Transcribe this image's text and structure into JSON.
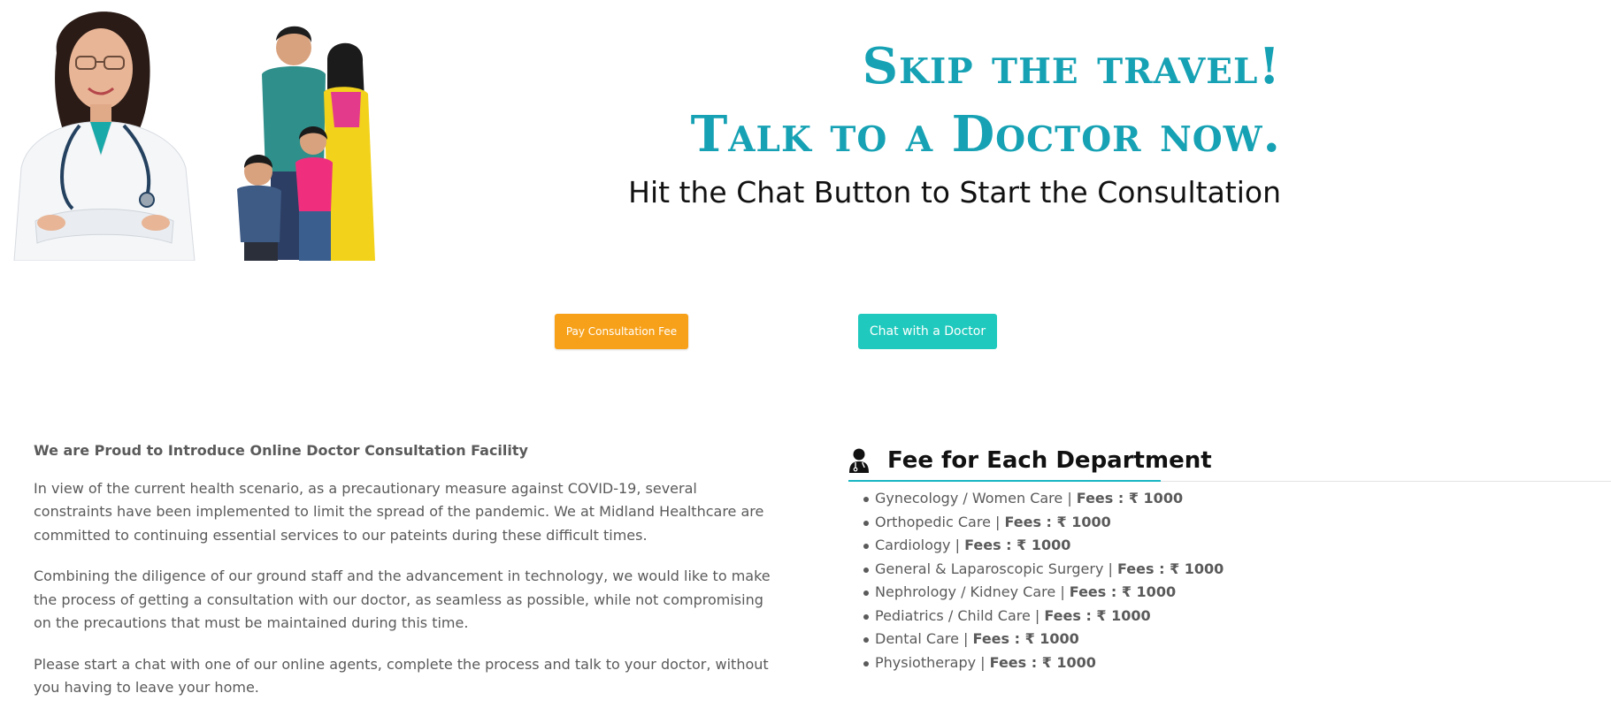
{
  "hero": {
    "line_1": "Skip the travel!",
    "line_2": "Talk to a Doctor now.",
    "subtitle": "Hit the Chat Button to Start the Consultation"
  },
  "buttons": {
    "pay_label": "Pay Consultation Fee",
    "chat_label": "Chat with a Doctor"
  },
  "intro": {
    "heading": "We are Proud to Introduce Online Doctor Consultation Facility",
    "paragraphs": [
      "In view of the current health scenario, as a precautionary measure against COVID-19, several constraints have been implemented to limit the spread of the pandemic. We at Midland Healthcare are committed to continuing essential services to our pateints during these difficult times.",
      "Combining the diligence of our ground staff and the advancement in technology, we would like to make the process of getting a consultation with our doctor, as seamless as possible, while not compromising on the precautions that must be maintained during this time.",
      "Please start a chat with one of our online agents, complete the process and talk to your doctor, without you having to leave your home."
    ]
  },
  "fees": {
    "title": "Fee for Each Department",
    "icon": "doctor-icon",
    "separator": " | ",
    "items": [
      {
        "department": "Gynecology / Women Care",
        "fee": "Fees : ₹ 1000"
      },
      {
        "department": "Orthopedic Care",
        "fee": "Fees : ₹ 1000"
      },
      {
        "department": "Cardiology",
        "fee": "Fees : ₹ 1000"
      },
      {
        "department": "General & Laparoscopic Surgery",
        "fee": "Fees : ₹ 1000"
      },
      {
        "department": "Nephrology / Kidney Care ",
        "fee": "Fees : ₹ 1000"
      },
      {
        "department": "Pediatrics / Child Care",
        "fee": "Fees : ₹ 1000"
      },
      {
        "department": "Dental Care",
        "fee": "Fees : ₹ 1000"
      },
      {
        "department": "Physiotherapy",
        "fee": "Fees : ₹ 1000"
      }
    ]
  },
  "colors": {
    "accent_teal": "#16a2b4",
    "pay_button": "#f7a11a",
    "chat_button": "#1fc9bd"
  }
}
